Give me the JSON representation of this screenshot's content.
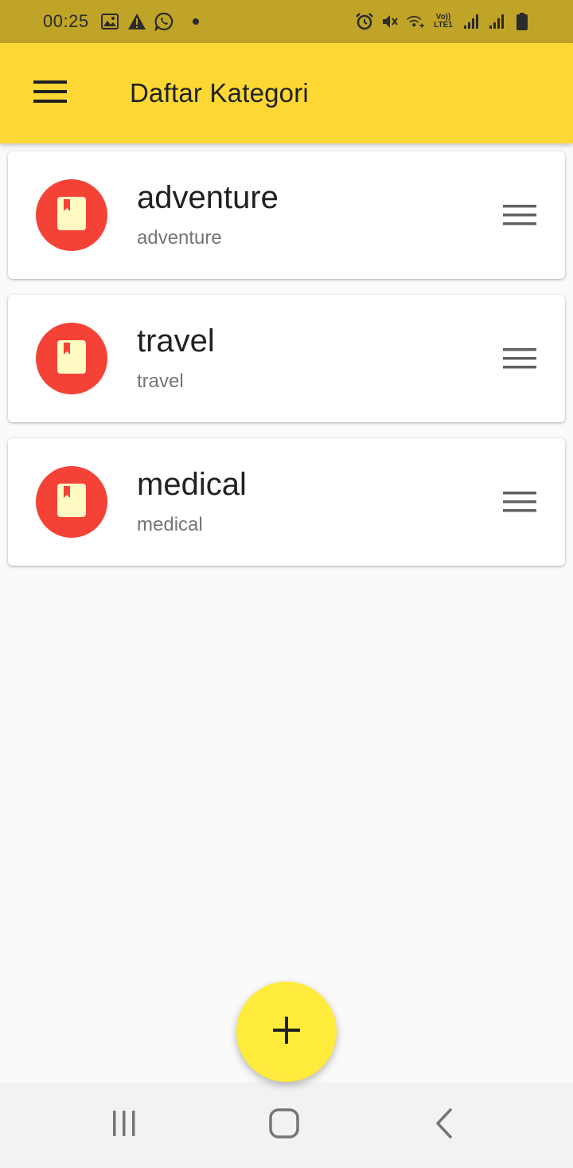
{
  "status_bar": {
    "time": "00:25",
    "icons_left": [
      "image-icon",
      "warning-icon",
      "whatsapp-icon",
      "dot-icon"
    ],
    "icons_right": [
      "alarm-icon",
      "mute-icon",
      "wifi-calling-icon",
      "volte-icon",
      "signal-1-icon",
      "signal-2-icon",
      "battery-icon"
    ],
    "volte_line1": "Vo))",
    "volte_line2": "LTE1"
  },
  "app_bar": {
    "title": "Daftar Kategori",
    "menu_icon": "menu-icon",
    "color": "#fdd835"
  },
  "categories": [
    {
      "title": "adventure",
      "subtitle": "adventure",
      "icon": "book-icon"
    },
    {
      "title": "travel",
      "subtitle": "travel",
      "icon": "book-icon"
    },
    {
      "title": "medical",
      "subtitle": "medical",
      "icon": "book-icon"
    }
  ],
  "colors": {
    "avatar": "#f44336",
    "book": "#fff9c4",
    "fab": "#ffeb3b",
    "status_bar": "#c0a428"
  },
  "fab": {
    "icon": "plus-icon"
  },
  "nav_bar": {
    "buttons": [
      "recent-apps-icon",
      "home-icon",
      "back-icon"
    ]
  }
}
